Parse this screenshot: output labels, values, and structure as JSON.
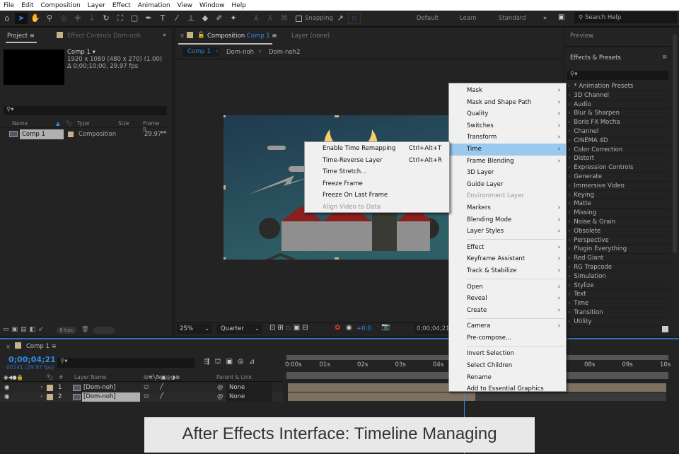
{
  "menubar": [
    "File",
    "Edit",
    "Composition",
    "Layer",
    "Effect",
    "Animation",
    "View",
    "Window",
    "Help"
  ],
  "toolbar": {
    "snapping": "Snapping",
    "workspaces": [
      "Default",
      "Learn",
      "Standard"
    ],
    "search_placeholder": "Search Help"
  },
  "project": {
    "tab": "Project",
    "effect_controls": "Effect Controls",
    "effect_controls_layer": "Dom-noh",
    "comp_name": "Comp 1 ▾",
    "comp_res": "1920 x 1080  (480 x 270) (1.00)",
    "comp_dur": "Δ 0;00;10;00, 29.97 fps",
    "columns": [
      "Name",
      "Type",
      "Size",
      "Frame R..."
    ],
    "item": {
      "name": "Comp 1",
      "type": "Composition",
      "fps": "29.97"
    },
    "bpc": "8 bpc"
  },
  "comp": {
    "tab_prefix": "Composition",
    "tab_name": "Comp 1",
    "layer_tab": "Layer (none)",
    "breadcrumbs": [
      "Comp 1",
      "Dom-noh",
      "Dom-noh2"
    ],
    "zoom": "25%",
    "resolution": "Quarter",
    "exposure": "+0.0",
    "timecode": "0;00;04;21"
  },
  "right": {
    "preview": "Preview",
    "effects_title": "Effects & Presets",
    "effects": [
      "* Animation Presets",
      "3D Channel",
      "Audio",
      "Blur & Sharpen",
      "Boris FX Mocha",
      "Channel",
      "CINEMA 4D",
      "Color Correction",
      "Distort",
      "Expression Controls",
      "Generate",
      "Immersive Video",
      "Keying",
      "Matte",
      "Missing",
      "Noise & Grain",
      "Obsolete",
      "Perspective",
      "Plugin Everything",
      "Red Giant",
      "RG Trapcode",
      "Simulation",
      "Stylize",
      "Text",
      "Time",
      "Transition",
      "Utility"
    ]
  },
  "context_menu": [
    {
      "label": "Mask",
      "sub": true
    },
    {
      "label": "Mask and Shape Path",
      "sub": true
    },
    {
      "label": "Quality",
      "sub": true
    },
    {
      "label": "Switches",
      "sub": true
    },
    {
      "label": "Transform",
      "sub": true
    },
    {
      "label": "Time",
      "sub": true,
      "active": true
    },
    {
      "label": "Frame Blending",
      "sub": true
    },
    {
      "label": "3D Layer"
    },
    {
      "label": "Guide Layer"
    },
    {
      "label": "Environment Layer",
      "disabled": true
    },
    {
      "label": "Markers",
      "sub": true
    },
    {
      "label": "Blending Mode",
      "sub": true
    },
    {
      "label": "Layer Styles",
      "sub": true
    },
    {
      "sep": true
    },
    {
      "label": "Effect",
      "sub": true
    },
    {
      "label": "Keyframe Assistant",
      "sub": true
    },
    {
      "label": "Track & Stabilize",
      "sub": true
    },
    {
      "sep": true
    },
    {
      "label": "Open",
      "sub": true
    },
    {
      "label": "Reveal",
      "sub": true
    },
    {
      "label": "Create",
      "sub": true
    },
    {
      "sep": true
    },
    {
      "label": "Camera",
      "sub": true
    },
    {
      "label": "Pre-compose..."
    },
    {
      "sep": true
    },
    {
      "label": "Invert Selection"
    },
    {
      "label": "Select Children"
    },
    {
      "label": "Rename"
    },
    {
      "label": "Add to Essential Graphics"
    }
  ],
  "time_submenu": [
    {
      "label": "Enable Time Remapping",
      "shortcut": "Ctrl+Alt+T"
    },
    {
      "label": "Time-Reverse Layer",
      "shortcut": "Ctrl+Alt+R"
    },
    {
      "label": "Time Stretch..."
    },
    {
      "label": "Freeze Frame"
    },
    {
      "label": "Freeze On Last Frame"
    },
    {
      "label": "Align Video to Data",
      "disabled": true
    }
  ],
  "timeline": {
    "tab": "Comp 1",
    "timecode": "0;00;04;21",
    "frames": "00141 (29.97 fps)",
    "col_layer": "Layer Name",
    "col_parent": "Parent & Link",
    "ruler": [
      "0:00s",
      "01s",
      "02s",
      "03s",
      "04s",
      "08s",
      "09s",
      "10s"
    ],
    "layers": [
      {
        "num": "1",
        "name": "[Dom-noh]",
        "parent": "None"
      },
      {
        "num": "2",
        "name": "[Dom-noh]",
        "parent": "None"
      }
    ],
    "playhead_seconds": 4.7
  },
  "caption": "After Effects Interface: Timeline Managing"
}
